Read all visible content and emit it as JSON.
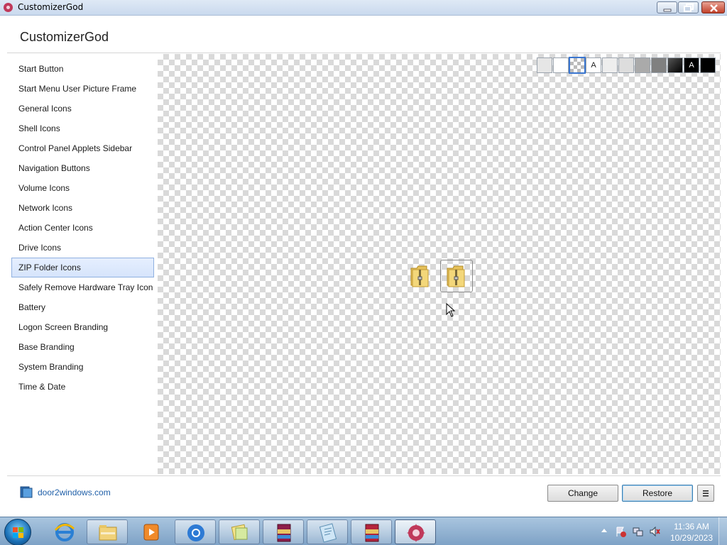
{
  "window": {
    "title": "CustomizerGod"
  },
  "header": {
    "title": "CustomizerGod"
  },
  "sidebar": {
    "items": [
      {
        "label": "Start Button"
      },
      {
        "label": "Start Menu User Picture Frame"
      },
      {
        "label": "General Icons"
      },
      {
        "label": "Shell Icons"
      },
      {
        "label": "Control Panel Applets Sidebar"
      },
      {
        "label": "Navigation Buttons"
      },
      {
        "label": "Volume Icons"
      },
      {
        "label": "Network Icons"
      },
      {
        "label": "Action Center Icons"
      },
      {
        "label": "Drive Icons"
      },
      {
        "label": "ZIP Folder Icons",
        "selected": true
      },
      {
        "label": "Safely Remove Hardware Tray Icon"
      },
      {
        "label": "Battery"
      },
      {
        "label": "Logon Screen Branding"
      },
      {
        "label": "Base Branding"
      },
      {
        "label": "System Branding"
      },
      {
        "label": "Time & Date"
      }
    ]
  },
  "background_swatches": [
    {
      "name": "light-gray",
      "color": "#e6e6e6",
      "text": ""
    },
    {
      "name": "white",
      "color": "#ffffff",
      "text": ""
    },
    {
      "name": "checker",
      "color": "checker",
      "text": "",
      "selected": true
    },
    {
      "name": "text-on-white",
      "color": "#ffffff",
      "text": "A"
    },
    {
      "name": "gray-1",
      "color": "#eeeeee",
      "text": ""
    },
    {
      "name": "gray-2",
      "color": "#dddddd",
      "text": ""
    },
    {
      "name": "gray-3",
      "color": "#aaaaaa",
      "text": ""
    },
    {
      "name": "gray-4",
      "color": "#808080",
      "text": ""
    },
    {
      "name": "dark-gradient",
      "color": "#222222",
      "text": ""
    },
    {
      "name": "text-on-black",
      "color": "#000000",
      "text": "A"
    },
    {
      "name": "black",
      "color": "#000000",
      "text": ""
    }
  ],
  "preview": {
    "icons": [
      "zip-folder-icon",
      "zip-folder-icon"
    ]
  },
  "footer": {
    "site_link": "door2windows.com",
    "change_label": "Change",
    "restore_label": "Restore",
    "menu_icon": "hamburger-icon"
  },
  "taskbar": {
    "apps": [
      {
        "name": "internet-explorer-icon",
        "state": "pinned"
      },
      {
        "name": "file-explorer-icon",
        "state": "open"
      },
      {
        "name": "media-player-icon",
        "state": "pinned"
      },
      {
        "name": "chrome-icon",
        "state": "open"
      },
      {
        "name": "sticky-notes-icon",
        "state": "open"
      },
      {
        "name": "winrar-icon",
        "state": "open"
      },
      {
        "name": "notepad-icon",
        "state": "open"
      },
      {
        "name": "winrar-archive-icon",
        "state": "open"
      },
      {
        "name": "customizergod-icon",
        "state": "active"
      }
    ],
    "clock": {
      "time": "11:36 AM",
      "date": "10/29/2023"
    }
  },
  "colors": {
    "selection_bg": "#dde8fc",
    "selection_border": "#8fb0e0",
    "link": "#1f5fa8"
  }
}
